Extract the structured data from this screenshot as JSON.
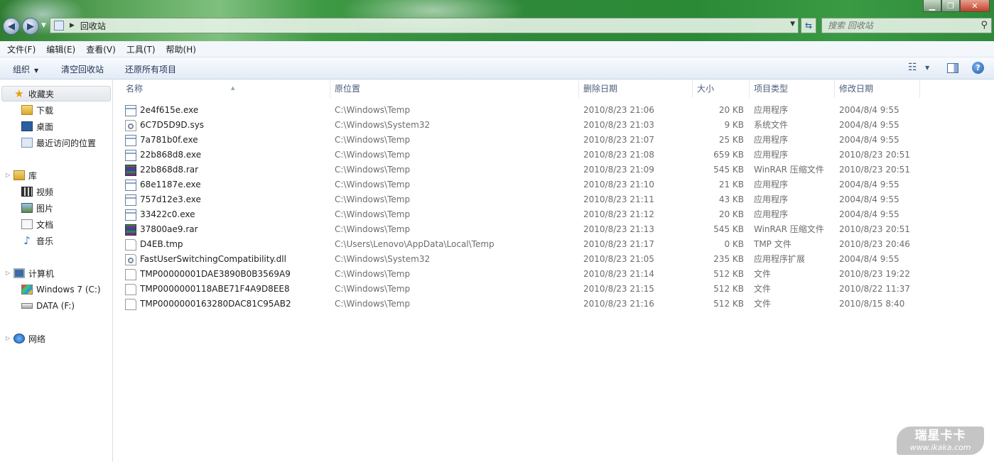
{
  "address": {
    "path": "回收站"
  },
  "search": {
    "placeholder": "搜索 回收站"
  },
  "menu": [
    "文件(F)",
    "编辑(E)",
    "查看(V)",
    "工具(T)",
    "帮助(H)"
  ],
  "toolbar": {
    "organize": "组织",
    "empty_bin": "清空回收站",
    "restore_all": "还原所有项目"
  },
  "nav": {
    "favorites": {
      "label": "收藏夹",
      "items": [
        "下载",
        "桌面",
        "最近访问的位置"
      ]
    },
    "libraries": {
      "label": "库",
      "items": [
        "视频",
        "图片",
        "文档",
        "音乐"
      ]
    },
    "computer": {
      "label": "计算机",
      "items": [
        "Windows 7 (C:)",
        "DATA (F:)"
      ]
    },
    "network": {
      "label": "网络"
    }
  },
  "columns": [
    "名称",
    "原位置",
    "删除日期",
    "大小",
    "项目类型",
    "修改日期"
  ],
  "files": [
    {
      "name": "2e4f615e.exe",
      "icon": "exe",
      "location": "C:\\Windows\\Temp",
      "deleted": "2010/8/23 21:06",
      "size": "20 KB",
      "type": "应用程序",
      "modified": "2004/8/4 9:55"
    },
    {
      "name": "6C7D5D9D.sys",
      "icon": "sys",
      "location": "C:\\Windows\\System32",
      "deleted": "2010/8/23 21:03",
      "size": "9 KB",
      "type": "系统文件",
      "modified": "2004/8/4 9:55"
    },
    {
      "name": "7a781b0f.exe",
      "icon": "exe",
      "location": "C:\\Windows\\Temp",
      "deleted": "2010/8/23 21:07",
      "size": "25 KB",
      "type": "应用程序",
      "modified": "2004/8/4 9:55"
    },
    {
      "name": "22b868d8.exe",
      "icon": "exe",
      "location": "C:\\Windows\\Temp",
      "deleted": "2010/8/23 21:08",
      "size": "659 KB",
      "type": "应用程序",
      "modified": "2010/8/23 20:51"
    },
    {
      "name": "22b868d8.rar",
      "icon": "rar",
      "location": "C:\\Windows\\Temp",
      "deleted": "2010/8/23 21:09",
      "size": "545 KB",
      "type": "WinRAR 压缩文件",
      "modified": "2010/8/23 20:51"
    },
    {
      "name": "68e1187e.exe",
      "icon": "exe",
      "location": "C:\\Windows\\Temp",
      "deleted": "2010/8/23 21:10",
      "size": "21 KB",
      "type": "应用程序",
      "modified": "2004/8/4 9:55"
    },
    {
      "name": "757d12e3.exe",
      "icon": "exe",
      "location": "C:\\Windows\\Temp",
      "deleted": "2010/8/23 21:11",
      "size": "43 KB",
      "type": "应用程序",
      "modified": "2004/8/4 9:55"
    },
    {
      "name": "33422c0.exe",
      "icon": "exe",
      "location": "C:\\Windows\\Temp",
      "deleted": "2010/8/23 21:12",
      "size": "20 KB",
      "type": "应用程序",
      "modified": "2004/8/4 9:55"
    },
    {
      "name": "37800ae9.rar",
      "icon": "rar",
      "location": "C:\\Windows\\Temp",
      "deleted": "2010/8/23 21:13",
      "size": "545 KB",
      "type": "WinRAR 压缩文件",
      "modified": "2010/8/23 20:51"
    },
    {
      "name": "D4EB.tmp",
      "icon": "file",
      "location": "C:\\Users\\Lenovo\\AppData\\Local\\Temp",
      "deleted": "2010/8/23 21:17",
      "size": "0 KB",
      "type": "TMP 文件",
      "modified": "2010/8/23 20:46"
    },
    {
      "name": "FastUserSwitchingCompatibility.dll",
      "icon": "sys",
      "location": "C:\\Windows\\System32",
      "deleted": "2010/8/23 21:05",
      "size": "235 KB",
      "type": "应用程序扩展",
      "modified": "2004/8/4 9:55"
    },
    {
      "name": "TMP00000001DAE3890B0B3569A9",
      "icon": "file",
      "location": "C:\\Windows\\Temp",
      "deleted": "2010/8/23 21:14",
      "size": "512 KB",
      "type": "文件",
      "modified": "2010/8/23 19:22"
    },
    {
      "name": "TMP0000000118ABE71F4A9D8EE8",
      "icon": "file",
      "location": "C:\\Windows\\Temp",
      "deleted": "2010/8/23 21:15",
      "size": "512 KB",
      "type": "文件",
      "modified": "2010/8/22 11:37"
    },
    {
      "name": "TMP0000000163280DAC81C95AB2",
      "icon": "file",
      "location": "C:\\Windows\\Temp",
      "deleted": "2010/8/23 21:16",
      "size": "512 KB",
      "type": "文件",
      "modified": "2010/8/15 8:40"
    }
  ],
  "watermark": {
    "line1": "瑞星卡卡",
    "line2": "www.ikaka.com"
  }
}
